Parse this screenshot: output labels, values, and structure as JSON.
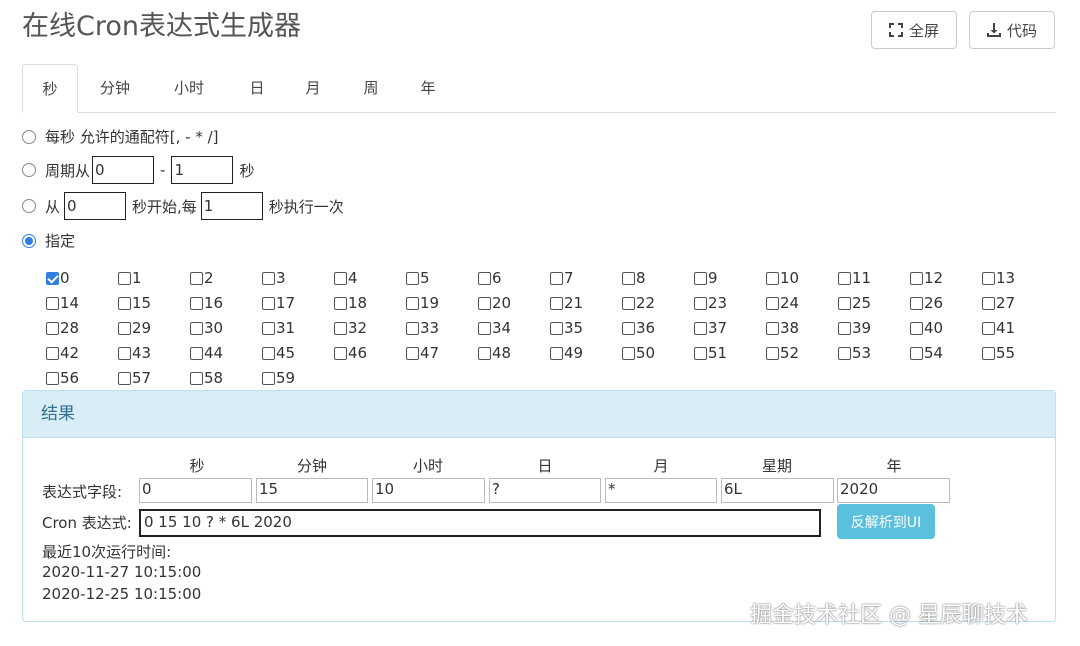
{
  "app": {
    "title": "在线Cron表达式生成器"
  },
  "toolbar": {
    "fullscreen_label": "全屏",
    "code_label": "代码"
  },
  "tabs": [
    {
      "label": "秒",
      "active": true
    },
    {
      "label": "分钟"
    },
    {
      "label": "小时"
    },
    {
      "label": "日"
    },
    {
      "label": "月"
    },
    {
      "label": "周"
    },
    {
      "label": "年"
    }
  ],
  "options": {
    "every": {
      "label": "每秒 允许的通配符[, - * /]"
    },
    "cycle": {
      "prefix": "周期从",
      "from": "0",
      "sep": "-",
      "to": "1",
      "suffix": "秒"
    },
    "start": {
      "prefix": "从",
      "start_value": "0",
      "middle": "秒开始,每",
      "every_value": "1",
      "suffix": "秒执行一次"
    },
    "specify": {
      "label": "指定"
    }
  },
  "seconds": [
    "0",
    "1",
    "2",
    "3",
    "4",
    "5",
    "6",
    "7",
    "8",
    "9",
    "10",
    "11",
    "12",
    "13",
    "14",
    "15",
    "16",
    "17",
    "18",
    "19",
    "20",
    "21",
    "22",
    "23",
    "24",
    "25",
    "26",
    "27",
    "28",
    "29",
    "30",
    "31",
    "32",
    "33",
    "34",
    "35",
    "36",
    "37",
    "38",
    "39",
    "40",
    "41",
    "42",
    "43",
    "44",
    "45",
    "46",
    "47",
    "48",
    "49",
    "50",
    "51",
    "52",
    "53",
    "54",
    "55",
    "56",
    "57",
    "58",
    "59"
  ],
  "checked_seconds": [
    "0"
  ],
  "result": {
    "heading": "结果",
    "columns": [
      "秒",
      "分钟",
      "小时",
      "日",
      "月",
      "星期",
      "年"
    ],
    "fields_label": "表达式字段:",
    "field_values": [
      "0",
      "15",
      "10",
      "?",
      "*",
      "6L",
      "2020"
    ],
    "cron_label": "Cron 表达式:",
    "cron_value": "0 15 10 ? * 6L 2020",
    "parse_button": "反解析到UI",
    "recent_label": "最近10次运行时间:",
    "recent_runs": [
      "2020-11-27 10:15:00",
      "2020-12-25 10:15:00"
    ]
  },
  "watermark": "掘金技术社区 @ 星辰聊技术",
  "colors": {
    "accent": "#2f7ee0",
    "panel_bg": "#d9edf7",
    "panel_text": "#31708f",
    "button_info": "#5bc0de"
  }
}
